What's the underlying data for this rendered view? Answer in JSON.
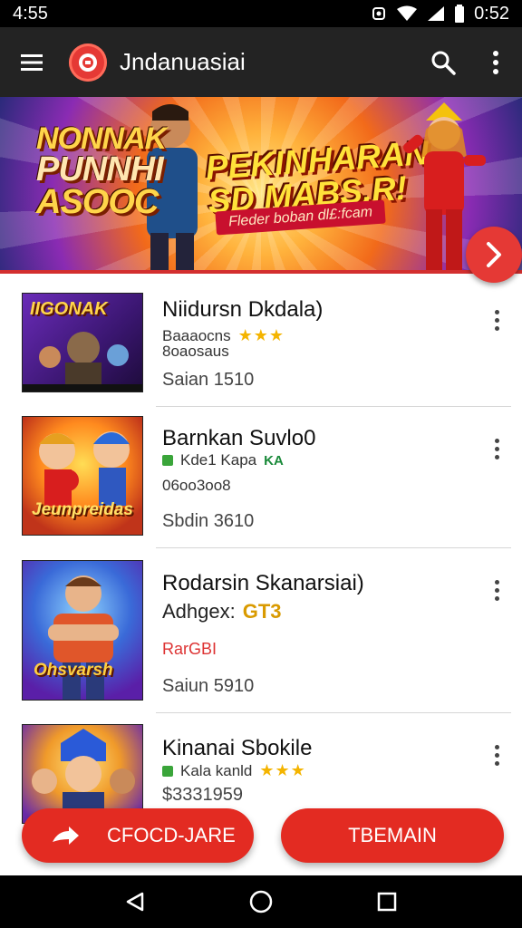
{
  "status_bar": {
    "time_left": "4:55",
    "time_right": "0:52",
    "icons": [
      "notification-icon",
      "wifi-icon",
      "signal-icon",
      "battery-icon"
    ]
  },
  "app_bar": {
    "title": "Jndanuasiai",
    "icons": [
      "menu-icon",
      "app-logo-icon",
      "search-icon",
      "more-vert-icon"
    ]
  },
  "banner": {
    "left_art_lines": [
      "NONNAK",
      "PUNNHI",
      "ASOOC"
    ],
    "title_line1": "PEKINHARAN",
    "title_line2": "SD MABS.R!",
    "subtitle": "Fleder boban dl£:fcam",
    "arrow_icon": "chevron-right-icon"
  },
  "games": [
    {
      "title": "Niidursn Dkdala)",
      "sub1": "Baaaocns",
      "sub2": "8oaosaus",
      "stars": "★★★",
      "price": "Saian  1510",
      "thumb_art": "IIGONAK"
    },
    {
      "title": "Barnkan Suvlo0",
      "sub1": "Kde1 Kapa",
      "sub2": "06oo3oo8",
      "badge": "KA",
      "price": "Sbdin  3610",
      "thumb_art": "Jeunpreidas"
    },
    {
      "title": "Rodarsin Skanarsiai)",
      "sub1": "Adhgex:",
      "tag": "GT3",
      "extra": "RarGBI",
      "price": "Saiun  5910",
      "thumb_art": "Ohsvarsh"
    },
    {
      "title": "Kinanai Sbokile",
      "sub1": "Kala kanld",
      "stars": "★★★",
      "price": "$3331959",
      "thumb_art": ""
    }
  ],
  "buttons": {
    "left_label": "CFOCD-JARE",
    "right_label": "TBEMAIN"
  },
  "nav": {
    "icons": [
      "back-icon",
      "home-icon",
      "recents-icon"
    ]
  },
  "colors": {
    "accent": "#e32b22",
    "app_bar": "#232323",
    "status_bar": "#000000"
  }
}
